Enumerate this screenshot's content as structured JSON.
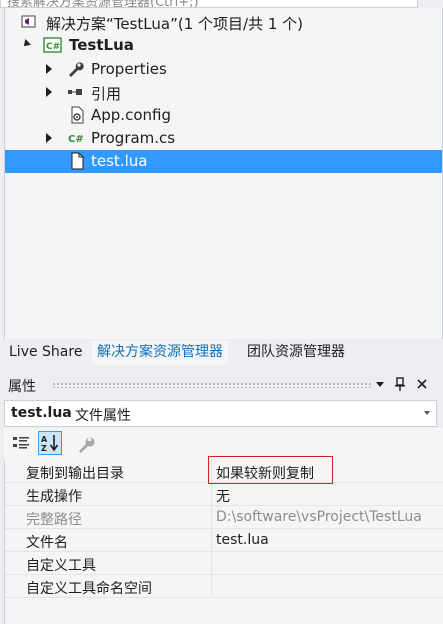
{
  "search": {
    "placeholder": "搜索解决方案资源管理器(Ctrl+;)"
  },
  "tree": {
    "solution_label": "解决方案“TestLua”(1 个项目/共 1 个)",
    "project_label": "TestLua",
    "items": [
      {
        "label": "Properties",
        "icon": "wrench-icon"
      },
      {
        "label": "引用",
        "icon": "references-icon"
      },
      {
        "label": "App.config",
        "icon": "config-file-icon"
      },
      {
        "label": "Program.cs",
        "icon": "csharp-file-icon"
      },
      {
        "label": "test.lua",
        "icon": "file-icon",
        "selected": true
      }
    ]
  },
  "tabs": [
    {
      "label": "Live Share"
    },
    {
      "label": "解决方案资源管理器",
      "active": true
    },
    {
      "label": "团队资源管理器"
    }
  ],
  "properties": {
    "title": "属性",
    "object_name": "test.lua",
    "object_type": "文件属性",
    "rows": [
      {
        "name": "复制到输出目录",
        "value": "如果较新则复制"
      },
      {
        "name": "生成操作",
        "value": "无"
      },
      {
        "name": "完整路径",
        "value": "D:\\software\\vsProject\\TestLua",
        "disabled": true
      },
      {
        "name": "文件名",
        "value": "test.lua"
      },
      {
        "name": "自定义工具",
        "value": ""
      },
      {
        "name": "自定义工具命名空间",
        "value": ""
      }
    ]
  },
  "colors": {
    "accent": "#3399ff",
    "active_tab_text": "#0e70c0",
    "highlight_border": "#d02424"
  }
}
